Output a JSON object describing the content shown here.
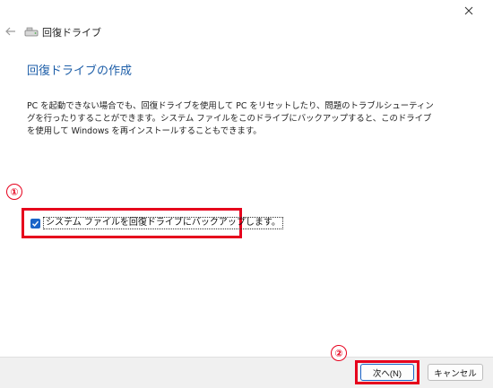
{
  "window": {
    "title": "回復ドライブ",
    "close_glyph": "✕"
  },
  "page": {
    "heading": "回復ドライブの作成",
    "description": "PC を起動できない場合でも、回復ドライブを使用して PC をリセットしたり、問題のトラブルシューティングを行ったりすることができます。システム ファイルをこのドライブにバックアップすると、このドライブを使用して Windows を再インストールすることもできます。"
  },
  "options": {
    "backup_system_files": {
      "label": "システム ファイルを回復ドライブにバックアップします。",
      "checked": true
    }
  },
  "annotations": {
    "marker_1": "①",
    "marker_2": "②",
    "color": "#e6001c"
  },
  "buttons": {
    "next": "次へ(N)",
    "cancel": "キャンセル"
  },
  "colors": {
    "heading": "#1d5ea8",
    "checkbox": "#1a64c8",
    "footer": "#f0f0f0"
  },
  "icons": {
    "close": "close-icon",
    "back": "back-arrow-icon",
    "drive": "drive-icon",
    "check": "check-icon"
  }
}
